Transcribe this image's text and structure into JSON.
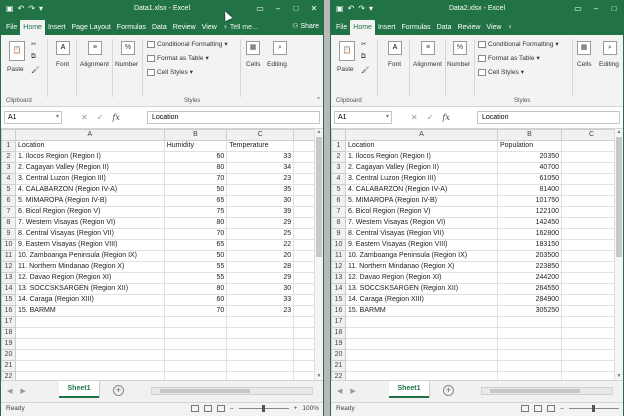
{
  "windows": [
    {
      "title": "Data1.xlsx - Excel",
      "tabs": [
        "File",
        "Home",
        "Insert",
        "Page Layout",
        "Formulas",
        "Data",
        "Review",
        "View"
      ],
      "active_tab": "Home",
      "tell_me": "Tell me...",
      "share": "Share",
      "ribbon": {
        "paste": "Paste",
        "clipboard": "Clipboard",
        "font": "Font",
        "alignment": "Alignment",
        "number": "Number",
        "conditional_formatting": "Conditional Formatting",
        "format_as_table": "Format as Table",
        "cell_styles": "Cell Styles",
        "styles": "Styles",
        "cells": "Cells",
        "editing": "Editing"
      },
      "name_box": "A1",
      "formula": "Location",
      "columns": [
        "A",
        "B",
        "C"
      ],
      "rows": [
        [
          "Location",
          "Humidity",
          "Temperature"
        ],
        [
          "1. Ilocos Region (Region I)",
          "60",
          "33"
        ],
        [
          "2. Cagayan Valley (Region II)",
          "80",
          "34"
        ],
        [
          "3. Central Luzon (Region III)",
          "70",
          "23"
        ],
        [
          "4. CALABARZON (Region IV-A)",
          "50",
          "35"
        ],
        [
          "5. MIMAROPA (Region IV-B)",
          "65",
          "30"
        ],
        [
          "6. Bicol Region (Region V)",
          "75",
          "39"
        ],
        [
          "7. Western Visayas (Region VI)",
          "80",
          "29"
        ],
        [
          "8. Central Visayas (Region VII)",
          "70",
          "25"
        ],
        [
          "9. Eastern Visayas (Region VIII)",
          "65",
          "22"
        ],
        [
          "10. Zamboanga Peninsula (Region IX)",
          "50",
          "20"
        ],
        [
          "11. Northern Mindanao (Region X)",
          "55",
          "28"
        ],
        [
          "12. Davao Region (Region XI)",
          "55",
          "29"
        ],
        [
          "13. SOCCSKSARGEN (Region XII)",
          "80",
          "30"
        ],
        [
          "14. Caraga (Region XIII)",
          "60",
          "33"
        ],
        [
          "15. BARMM",
          "70",
          "23"
        ]
      ],
      "sheet_tab": "Sheet1",
      "add_sheet": "+",
      "status": "Ready",
      "zoom": "100%"
    },
    {
      "title": "Data2.xlsx - Excel",
      "tabs": [
        "File",
        "Home",
        "Insert",
        "Formulas",
        "Data",
        "Review",
        "View"
      ],
      "active_tab": "Home",
      "ribbon": {
        "paste": "Paste",
        "clipboard": "Clipboard",
        "font": "Font",
        "alignment": "Alignment",
        "number": "Number",
        "conditional_formatting": "Conditional Formatting",
        "format_as_table": "Format as Table",
        "cell_styles": "Cell Styles",
        "styles": "Styles",
        "cells": "Cells",
        "editing": "Editing"
      },
      "name_box": "A1",
      "formula": "Location",
      "columns": [
        "A",
        "B",
        "C"
      ],
      "rows": [
        [
          "Location",
          "Population"
        ],
        [
          "1. Ilocos Region (Region I)",
          "20350"
        ],
        [
          "2. Cagayan Valley (Region II)",
          "40700"
        ],
        [
          "3. Central Luzon (Region III)",
          "61050"
        ],
        [
          "4. CALABARZON (Region IV-A)",
          "81400"
        ],
        [
          "5. MIMAROPA (Region IV-B)",
          "101750"
        ],
        [
          "6. Bicol Region (Region V)",
          "122100"
        ],
        [
          "7. Western Visayas (Region VI)",
          "142450"
        ],
        [
          "8. Central Visayas (Region VII)",
          "162800"
        ],
        [
          "9. Eastern Visayas (Region VIII)",
          "183150"
        ],
        [
          "10. Zamboanga Peninsula (Region IX)",
          "203500"
        ],
        [
          "11. Northern Mindanao (Region X)",
          "223850"
        ],
        [
          "12. Davao Region (Region XI)",
          "244200"
        ],
        [
          "13. SOCCSKSARGEN (Region XII)",
          "264550"
        ],
        [
          "14. Caraga (Region XIII)",
          "284900"
        ],
        [
          "15. BARMM",
          "305250"
        ]
      ],
      "sheet_tab": "Sheet1",
      "add_sheet": "+",
      "status": "Ready"
    }
  ],
  "colors": {
    "excel_green": "#217346",
    "ribbon_bg": "#f3f3f3"
  }
}
